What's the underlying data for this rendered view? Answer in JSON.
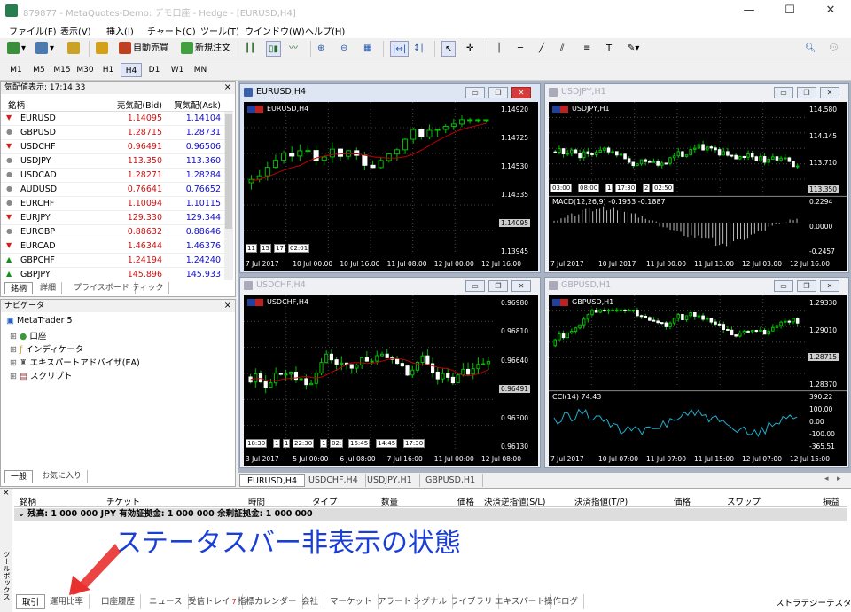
{
  "window": {
    "title": "879877 - MetaQuotes-Demo: デモ口座 - Hedge - [EURUSD,H4]",
    "minimize": "—",
    "maximize": "☐",
    "close": "✕"
  },
  "menu": [
    "ファイル(F)",
    "表示(V)",
    "挿入(I)",
    "チャート(C)",
    "ツール(T)",
    "ウインドウ(W)",
    "ヘルプ(H)"
  ],
  "toolbar": {
    "auto_trade": "自動売買",
    "new_order": "新規注文"
  },
  "timeframes": [
    "M1",
    "M5",
    "M15",
    "M30",
    "H1",
    "H4",
    "D1",
    "W1",
    "MN"
  ],
  "active_timeframe": "H4",
  "market_watch": {
    "title": "気配値表示: 17:14:33",
    "headers": {
      "symbol": "銘柄",
      "bid": "売気配(Bid)",
      "ask": "買気配(Ask)"
    },
    "rows": [
      {
        "symbol": "EURUSD",
        "bid": "1.14095",
        "ask": "1.14104",
        "dir": "dn"
      },
      {
        "symbol": "GBPUSD",
        "bid": "1.28715",
        "ask": "1.28731",
        "dir": "neu"
      },
      {
        "symbol": "USDCHF",
        "bid": "0.96491",
        "ask": "0.96506",
        "dir": "dn"
      },
      {
        "symbol": "USDJPY",
        "bid": "113.350",
        "ask": "113.360",
        "dir": "neu"
      },
      {
        "symbol": "USDCAD",
        "bid": "1.28271",
        "ask": "1.28284",
        "dir": "neu"
      },
      {
        "symbol": "AUDUSD",
        "bid": "0.76641",
        "ask": "0.76652",
        "dir": "neu"
      },
      {
        "symbol": "EURCHF",
        "bid": "1.10094",
        "ask": "1.10115",
        "dir": "neu"
      },
      {
        "symbol": "EURJPY",
        "bid": "129.330",
        "ask": "129.344",
        "dir": "dn"
      },
      {
        "symbol": "EURGBP",
        "bid": "0.88632",
        "ask": "0.88646",
        "dir": "neu"
      },
      {
        "symbol": "EURCAD",
        "bid": "1.46344",
        "ask": "1.46376",
        "dir": "dn"
      },
      {
        "symbol": "GBPCHF",
        "bid": "1.24194",
        "ask": "1.24240",
        "dir": "up"
      },
      {
        "symbol": "GBPJPY",
        "bid": "145.896",
        "ask": "145.933",
        "dir": "up"
      }
    ],
    "tabs": [
      "銘柄",
      "詳細",
      "プライスボード",
      "ティック"
    ]
  },
  "navigator": {
    "title": "ナビゲータ",
    "root": "MetaTrader 5",
    "items": [
      "口座",
      "インディケータ",
      "エキスパートアドバイザ(EA)",
      "スクリプト"
    ],
    "tabs": [
      "一般",
      "お気に入り"
    ]
  },
  "charts": [
    {
      "id": "eurusd",
      "title": "EURUSD,H4",
      "label": "EURUSD,H4",
      "active": true,
      "prices": [
        "1.14920",
        "1.14725",
        "1.14530",
        "1.14335",
        "1.14095",
        "1.13945"
      ],
      "current": "1.14095",
      "times": [
        "7 Jul 2017",
        "10 Jul 00:00",
        "10 Jul 16:00",
        "11 Jul 08:00",
        "12 Jul 00:00",
        "12 Jul 16:00"
      ],
      "trade_labels": [
        "11",
        "15",
        "17",
        "02:01"
      ]
    },
    {
      "id": "usdjpy",
      "title": "USDJPY,H1",
      "label": "USDJPY,H1",
      "active": false,
      "prices": [
        "114.580",
        "114.145",
        "113.710",
        "113.350"
      ],
      "current": "113.350",
      "macd_label": "MACD(12,26,9) -0.1953 -0.1887",
      "macd_prices": [
        "0.2294",
        "0.0000",
        "-0.2457"
      ],
      "times": [
        "7 Jul 2017",
        "10 Jul 2017",
        "11 Jul 00:00",
        "11 Jul 13:00",
        "12 Jul 03:00",
        "12 Jul 16:00"
      ],
      "trade_labels": [
        "03:00",
        "08:00",
        "1",
        "17:30",
        "2",
        "02:50"
      ]
    },
    {
      "id": "usdchf",
      "title": "USDCHF,H4",
      "label": "USDCHF,H4",
      "active": false,
      "prices": [
        "0.96980",
        "0.96810",
        "0.96640",
        "0.96491",
        "0.96300",
        "0.96130"
      ],
      "current": "0.96491",
      "times": [
        "3 Jul 2017",
        "5 Jul 00:00",
        "6 Jul 08:00",
        "7 Jul 16:00",
        "11 Jul 00:00",
        "12 Jul 08:00"
      ],
      "trade_labels": [
        "18:30",
        "1",
        "1",
        "22:30",
        "1",
        "02:",
        "16:45",
        "14:45",
        "17:30"
      ]
    },
    {
      "id": "gbpusd",
      "title": "GBPUSD,H1",
      "label": "GBPUSD,H1",
      "active": false,
      "prices": [
        "1.29330",
        "1.29010",
        "1.28715",
        "1.28370"
      ],
      "current": "1.28715",
      "cci_label": "CCI(14) 74.43",
      "cci_prices": [
        "390.22",
        "100.00",
        "0.00",
        "-100.00",
        "-365.51"
      ],
      "times": [
        "7 Jul 2017",
        "10 Jul 07:00",
        "11 Jul 07:00",
        "11 Jul 15:00",
        "12 Jul 07:00",
        "12 Jul 15:00"
      ]
    }
  ],
  "chart_tabs": [
    "EURUSD,H4",
    "USDCHF,H4",
    "USDJPY,H1",
    "GBPUSD,H1"
  ],
  "toolbox": {
    "side_label": "ツールボックス",
    "columns": [
      "銘柄",
      "チケット",
      "時間",
      "タイプ",
      "数量",
      "価格",
      "決済逆指値(S/L)",
      "決済指値(T/P)",
      "価格",
      "スワップ",
      "損益"
    ],
    "balance_row": "残高: 1 000 000 JPY  有効証拠金: 1 000 000  余剰証拠金: 1 000 000",
    "annotation": "ステータスバー非表示の状態",
    "tabs": [
      "取引",
      "運用比率",
      "口座履歴",
      "ニュース",
      "受信トレイ",
      "指標カレンダー",
      "会社",
      "マーケット",
      "アラート",
      "シグナル",
      "ライブラリ",
      "エキスパート",
      "操作ログ"
    ],
    "inbox_count": "7",
    "strategy_tester": "ストラテジーテスター"
  },
  "colors": {
    "bull": "#ffffff",
    "bear": "#00c000",
    "ma": "#c00000",
    "accent": "#e8312f",
    "annotation": "#1a3fd8"
  }
}
